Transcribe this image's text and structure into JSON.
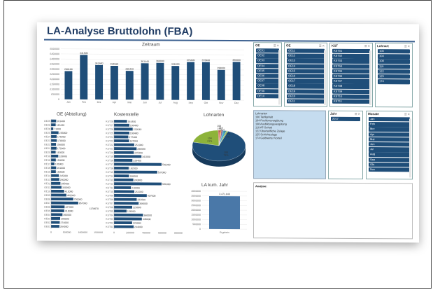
{
  "page": {
    "title": "LA-Analyse Bruttolohn (FBA)"
  },
  "colors": {
    "bar": "#1f4e79",
    "bar_light": "#4a78a8",
    "accent_green": "#8db33a",
    "title_blue": "#1f3b63"
  },
  "panels": {
    "zeitraum": "Zeitraum",
    "oe": "OE (Abteilung)",
    "kst": "Kostenstelle",
    "lohnarten": "Lohnarten",
    "kum": "LA kum. Jahr",
    "analyse": "Analyse:"
  },
  "slicers": [
    {
      "title": "OE",
      "items": [
        "OE01",
        "OE02",
        "OE03",
        "OE04",
        "OE05",
        "OE06",
        "OE07",
        "OE08",
        "OE09",
        "OE10"
      ]
    },
    {
      "title": "OE",
      "items": [
        "OE11",
        "OE12",
        "OE13",
        "OE14",
        "OE15",
        "OE16",
        "OE17",
        "OE18",
        "OE19",
        "OE10",
        "OE11"
      ]
    },
    {
      "title": "KST",
      "items": [
        "KST01",
        "KST02",
        "KST03",
        "KST04",
        "KST05",
        "KST06",
        "KST07",
        "KST08",
        "KST09",
        "KST10",
        "KST11"
      ]
    },
    {
      "title": "Lohnart",
      "items": [
        "100",
        "104",
        "108",
        "110",
        "122",
        "125",
        "174"
      ]
    },
    {
      "title": "Nachname",
      "items": [
        "M1",
        "M10",
        "M100",
        "M101",
        "M102",
        "M103",
        "M104",
        "M105",
        "M106",
        "M107",
        "M108"
      ]
    },
    {
      "title": "Jahr",
      "items": [
        "2017"
      ]
    },
    {
      "title": "Monate",
      "items": [
        "Jan",
        "Feb",
        "Mrz",
        "Apr",
        "Mai",
        "Jun",
        "Jul",
        "Aug",
        "Sep",
        "Okt",
        "Nov"
      ]
    }
  ],
  "legend": {
    "heading": "Lohnarten",
    "lines": [
      "100 Tarifgehalt",
      "104 Positionsvergütung",
      "108 Ausbildungsvergütung",
      "110 AT-Gehalt",
      "122 Übertarifliche Zulage",
      "125 Schichtzulage",
      "174 Geldwerter Vorteil"
    ]
  },
  "chart_data": [
    {
      "type": "bar",
      "title": "Zeitraum",
      "categories": [
        "Jan",
        "Feb",
        "Mrz",
        "Apr",
        "Mai",
        "Jun",
        "Jul",
        "Aug",
        "Sep",
        "Okt",
        "Nov",
        "Dez"
      ],
      "values": [
        280100,
        441500,
        341440,
        334560,
        285420,
        361440,
        366000,
        336400,
        376400,
        376400,
        299600,
        380000
      ],
      "data_labels": [
        "280100",
        "441500",
        "341440",
        "334560",
        "285420",
        "361440",
        "366000",
        "336400",
        "376400",
        "376400",
        "299600",
        "380000"
      ],
      "ylim": [
        0,
        500000
      ],
      "yticks": [
        "0",
        "£50000",
        "£100000",
        "£150000",
        "£200000",
        "£250000",
        "£300000",
        "£350000",
        "£400000",
        "£450000",
        "£500000"
      ]
    },
    {
      "type": "bar",
      "orientation": "horizontal",
      "title": "OE (Abteilung)",
      "categories": [
        "OE29",
        "OE28",
        "OE26",
        "OE25",
        "OE24",
        "OE23",
        "OE22",
        "OE21",
        "OE20",
        "OE19",
        "OE18",
        "OE17",
        "OE16",
        "OE15",
        "OE14",
        "OE13",
        "OE12",
        "OE11",
        "OE10",
        "OE09",
        "OE08",
        "OE07",
        "OE06",
        "OE05",
        "OE04",
        "OE03",
        "OE02",
        "OE01"
      ],
      "values": [
        161400,
        145440,
        71000,
        235000,
        175000,
        178000,
        156000,
        172000,
        145000,
        228000,
        150000,
        105000,
        161000,
        150000,
        245000,
        260000,
        295000,
        330000,
        412000,
        482000,
        700000,
        857000,
        427000,
        415000,
        360000,
        288000,
        274000,
        264000
      ],
      "xlim": [
        0,
        1500000
      ],
      "xticks": [
        "0",
        "500000",
        "1000000",
        "1500000"
      ],
      "annotation": "1178670"
    },
    {
      "type": "bar",
      "orientation": "horizontal",
      "title": "Kostenstelle",
      "categories": [
        "KST28",
        "KST27",
        "KST26",
        "KST25",
        "KST24",
        "KST23",
        "KST22",
        "KST21",
        "KST20",
        "KST19",
        "KST18",
        "KST17",
        "KST16",
        "KST15",
        "KST14",
        "KST13",
        "KST12",
        "KST11",
        "KST10",
        "KST09",
        "KST08",
        "KST07",
        "KST06",
        "KST05",
        "KST04",
        "KST03",
        "KST02",
        "KST01"
      ],
      "values": [
        161400,
        190480,
        232040,
        190480,
        177400,
        187000,
        251000,
        280560,
        245900,
        341000,
        228400,
        591000,
        182000,
        537000,
        186000,
        240000,
        591000,
        210000,
        252000,
        407000,
        282000,
        306000,
        226000,
        156000,
        360000,
        346000,
        225000,
        244000
      ],
      "xlim": [
        0,
        800000
      ],
      "xticks": [
        "0",
        "200000",
        "400000",
        "600000",
        "800000"
      ]
    },
    {
      "type": "pie",
      "title": "Lohnarten",
      "labels": [
        "100",
        "104",
        "108",
        "110",
        "122",
        "125",
        "174"
      ],
      "values": [
        73,
        21,
        1,
        1,
        1,
        2,
        1
      ],
      "data_labels": [
        "73%",
        "21%",
        "1%",
        "1%",
        "1%",
        "2%",
        "1%"
      ]
    },
    {
      "type": "bar",
      "title": "LA kum. Jahr",
      "categories": [
        "Ergebnis"
      ],
      "values": [
        3471840
      ],
      "data_labels": [
        "3.471.840"
      ],
      "ylim": [
        0,
        4000000
      ],
      "yticks": [
        "0",
        "500000",
        "1000000",
        "1500000",
        "2000000",
        "2500000",
        "3000000",
        "3500000",
        "4000000"
      ]
    }
  ]
}
